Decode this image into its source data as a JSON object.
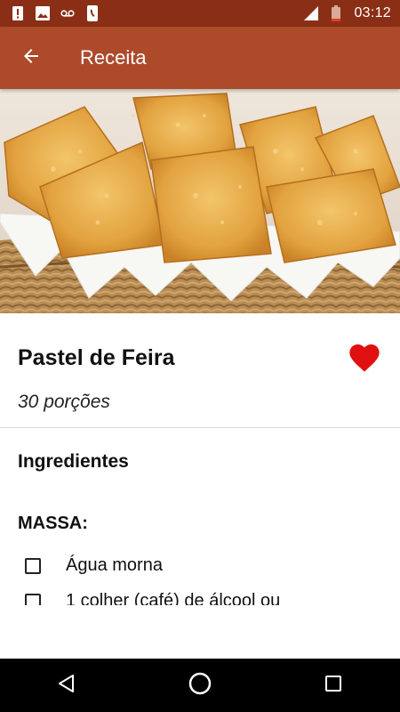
{
  "status_bar": {
    "time": "03:12",
    "icons": [
      "alert-icon",
      "image-icon",
      "voicemail-icon",
      "phone-icon",
      "signal-icon",
      "battery-icon"
    ]
  },
  "app_bar": {
    "title": "Receita",
    "back_icon": "arrow-back-icon",
    "background": "#ad4a2a"
  },
  "recipe": {
    "title": "Pastel de Feira",
    "favorite": true,
    "favorite_color": "#e01010",
    "servings": "30 porções",
    "image_description_icon": "recipe-photo"
  },
  "ingredients": {
    "section_title": "Ingredientes",
    "groups": [
      {
        "title": "MASSA:",
        "items": [
          {
            "text": "Água morna",
            "checked": false
          },
          {
            "text": "1 colher (café) de álcool ou",
            "checked": false
          }
        ]
      }
    ]
  },
  "nav_bar": {
    "icons": [
      "back-triangle-icon",
      "home-circle-icon",
      "recents-square-icon"
    ]
  }
}
